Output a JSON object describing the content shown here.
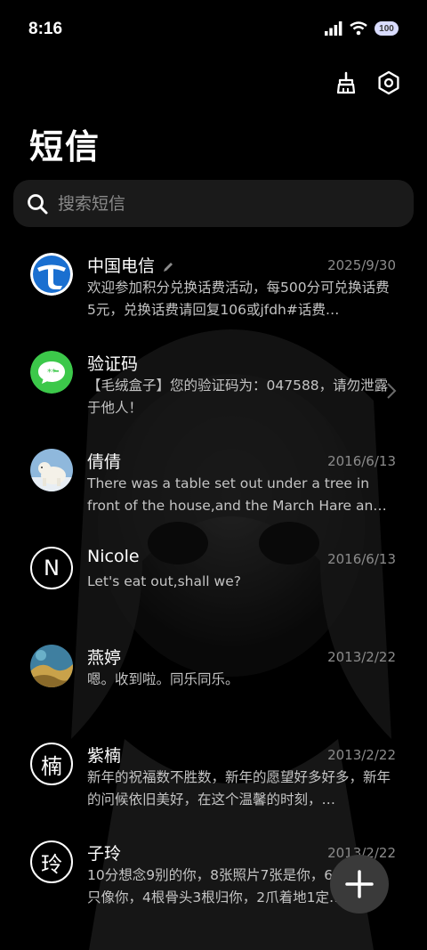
{
  "status_bar": {
    "time": "8:16",
    "battery": "100"
  },
  "page_title": "短信",
  "search": {
    "placeholder": "搜索短信"
  },
  "conversations": [
    {
      "name": "中国电信",
      "date": "2025/9/30",
      "preview": "欢迎参加积分兑换话费活动，每500分可兑换话费5元，兑换话费请回复106或jfdh#话费…",
      "avatar": "china-telecom-logo"
    },
    {
      "name": "验证码",
      "date": "",
      "preview": "【毛绒盒子】您的验证码为：047588，请勿泄露于他人！",
      "avatar": "message-bubble-icon"
    },
    {
      "name": "倩倩",
      "date": "2016/6/13",
      "preview": "There was a table set out under a tree in front of the house,and the March Hare an…",
      "avatar": "polar-bear-photo"
    },
    {
      "name": "Nicole",
      "date": "2016/6/13",
      "preview": "Let's eat out,shall we?",
      "avatar_letter": "N"
    },
    {
      "name": "燕婷",
      "date": "2013/2/22",
      "preview": "嗯。收到啦。同乐同乐。",
      "avatar": "landscape-photo"
    },
    {
      "name": "紫楠",
      "date": "2013/2/22",
      "preview": "新年的祝福数不胜数，新年的愿望好多好多，新年的问候依旧美好，在这个温馨的时刻，…",
      "avatar_letter": "楠"
    },
    {
      "name": "子玲",
      "date": "2013/2/22",
      "preview": "10分想念9别的你，8张照片7张是你，6只小狗5只像你，4根骨头3根归你，2爪着地1定…",
      "avatar_letter": "玲"
    }
  ],
  "colors": {
    "background": "#000000",
    "search_bg": "#1a1a1a",
    "fab_bg": "#3a3a3a",
    "sms_green": "#3cc84a",
    "telecom_blue": "#1a6fd0"
  }
}
